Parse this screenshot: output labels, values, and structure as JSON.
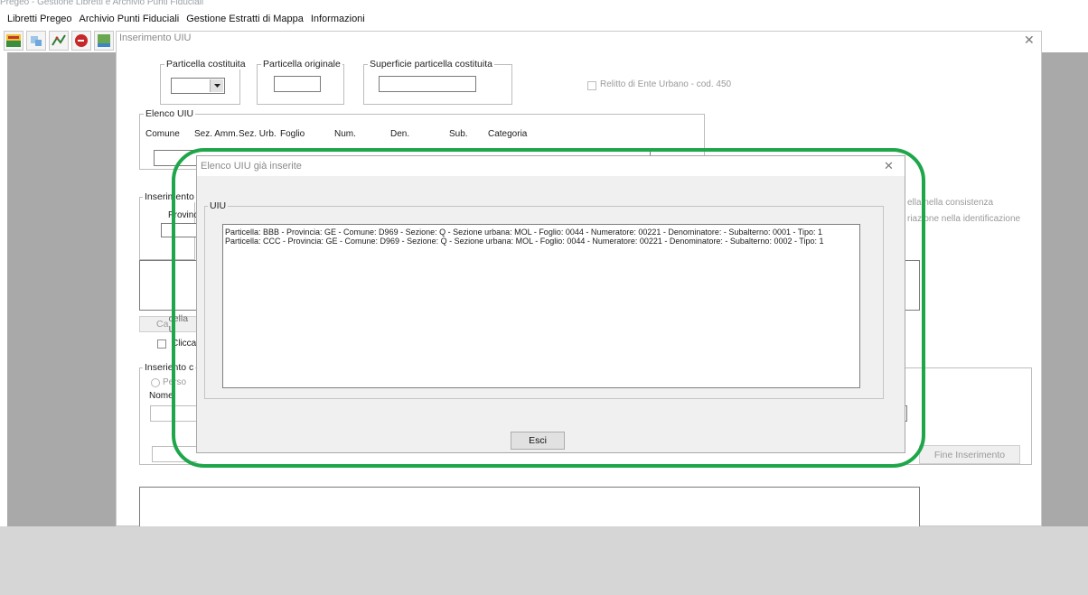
{
  "window_title_fragment": "Pregeo - Gestione Libretti e Archivio Punti Fiduciali",
  "menubar": {
    "items": [
      {
        "label": "Libretti Pregeo"
      },
      {
        "label": "Archivio Punti Fiduciali"
      },
      {
        "label": "Gestione Estratti di Mappa"
      },
      {
        "label": "Informazioni"
      }
    ]
  },
  "toolbar": {
    "icons": [
      "pregeo-icon",
      "puzzle-icon",
      "chart-icon",
      "e-icon",
      "elab-icon"
    ]
  },
  "main_window": {
    "title": "Inserimento UIU",
    "particella_costituita": {
      "label": "Particella costituita",
      "value": ""
    },
    "particella_originale": {
      "label": "Particella originale",
      "value": ""
    },
    "superficie": {
      "label": "Superficie particella costituita",
      "value": ""
    },
    "relitto": {
      "label": "Relitto di Ente Urbano - cod. 450",
      "checked": false
    },
    "elenco_uiu": {
      "label": "Elenco UIU",
      "headers": [
        "Comune",
        "Sez. Amm.",
        "Sez. Urb.",
        "Foglio",
        "Num.",
        "Den.",
        "Sub.",
        "Categoria"
      ]
    },
    "inserimento_label_partial": "Inserimento U",
    "provincia_partial": "Provinc",
    "option_right_1": "nella consistenza",
    "option_right_1_prefix": "ella ",
    "option_right_2": "riazione nella identificazione",
    "cancella_label_partial": "Cancella U",
    "cancella_prefix": "Ca",
    "cancella_suffix": "cella U",
    "cliccar_partial": "Cliccar",
    "inserimento2_partial": "Inserimento c",
    "inserimento2_prefix": "Inseri",
    "inserimento2_suffix": "ento c",
    "person_partial": "Perso",
    "nome_label": "Nome",
    "fine_inserimento": "Fine Inserimento"
  },
  "dialog": {
    "title": "Elenco UIU già inserite",
    "group_label": "UIU",
    "rows": [
      "Particella: BBB - Provincia: GE - Comune: D969 - Sezione: Q - Sezione urbana: MOL - Foglio: 0044 - Numeratore: 00221 - Denominatore:  - Subalterno: 0001 - Tipo: 1",
      "Particella: CCC - Provincia: GE - Comune: D969 - Sezione: Q - Sezione urbana: MOL - Foglio: 0044 - Numeratore: 00221 - Denominatore:  - Subalterno: 0002 - Tipo: 1"
    ],
    "exit_button": "Esci"
  },
  "colors": {
    "annotation_green": "#1fa64a",
    "desktop_gray": "#a9a9a9"
  }
}
